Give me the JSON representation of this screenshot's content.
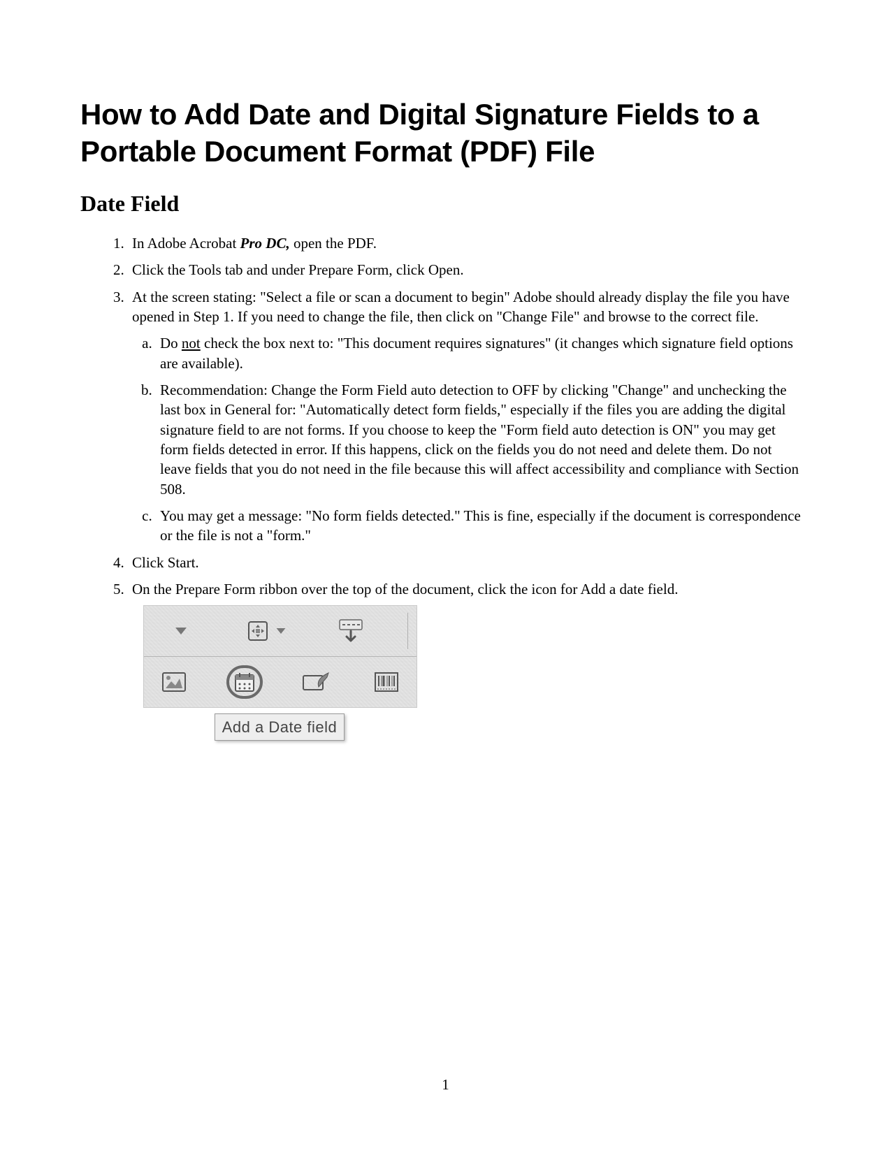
{
  "title": "How to Add Date and Digital Signature Fields to a Portable Document Format (PDF) File",
  "section_heading": "Date Field",
  "steps": {
    "s1_pre": "In Adobe Acrobat ",
    "s1_em": "Pro DC,",
    "s1_post": " open the PDF.",
    "s2": "Click the Tools tab and under Prepare Form, click Open.",
    "s3": "At the screen stating: \"Select a file or scan a document to begin\" Adobe should already display the file you have opened in Step 1.  If you need to change the file, then click on \"Change File\" and browse to the correct file.",
    "s3a_pre": "Do ",
    "s3a_u": "not",
    "s3a_post": " check the box next to: \"This document requires signatures\" (it changes which signature field options are available).",
    "s3b": "Recommendation:  Change the Form Field auto detection to OFF by clicking \"Change\" and unchecking the last box in General for: \"Automatically detect form fields,\" especially if the files you are adding the digital signature field to are not forms.  If you choose to keep the \"Form field auto detection is ON\" you may get form fields detected in error.  If this happens, click on the fields you do not need and delete them.  Do not leave fields that you do not need in the file because this will affect accessibility and compliance with Section 508.",
    "s3c": "You may get a message: \"No form fields detected.\"  This is fine, especially if the document is correspondence or the file is not a \"form.\"",
    "s4": "Click Start.",
    "s5": "On the Prepare Form ribbon over the top of the document, click the icon for Add a date field."
  },
  "toolbar": {
    "tooltip": "Add a Date field",
    "icons": {
      "dropdown": "dropdown-arrow-icon",
      "move": "move-handles-icon",
      "text_field": "text-field-arrow-icon",
      "image": "image-field-icon",
      "date": "date-field-icon",
      "signature": "signature-field-icon",
      "barcode": "barcode-field-icon"
    }
  },
  "page_number": "1"
}
